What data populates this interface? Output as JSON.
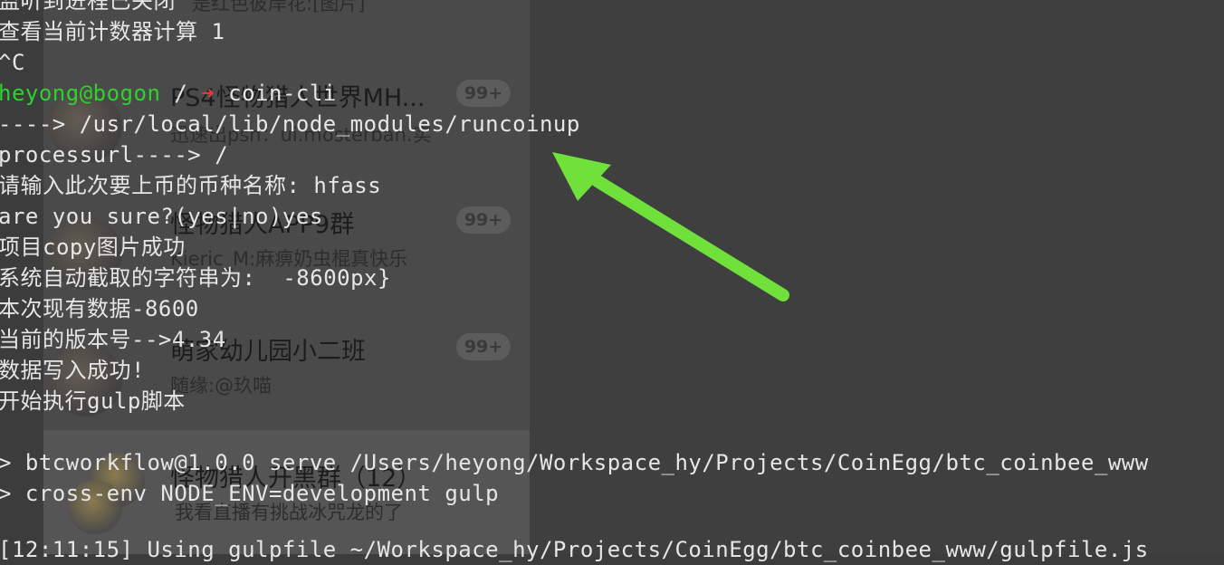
{
  "chat": {
    "items": [
      {
        "name": "PS4怪物猎人世界MH...",
        "preview": "迅速出psn：ui.mosterban.实",
        "badge": "99+"
      },
      {
        "name": "怪物猎人APP9群",
        "preview": "Kieric_M:麻痹奶虫棍真快乐",
        "badge": "99+"
      },
      {
        "name": "萌家幼儿园小二班",
        "preview": "随缘:@玖喵",
        "badge": "99+"
      },
      {
        "name": "怪物猎人开黑群（12）",
        "preview": "我看直播有挑战冰咒龙的了",
        "badge": ""
      }
    ],
    "top_preview": "是红色彼岸花:[图片]"
  },
  "terminal": {
    "lines": [
      {
        "text": "监听到进程已关闭"
      },
      {
        "text": "查看当前计数器计算 1"
      },
      {
        "text": "^C"
      },
      {
        "user": "heyong@bogon",
        "path": " / ",
        "arrow": "➜",
        "cmd": " coin-cli"
      },
      {
        "text": "----> /usr/local/lib/node_modules/runcoinup"
      },
      {
        "text": "processurl----> /"
      },
      {
        "text": "请输入此次要上币的币种名称: hfass"
      },
      {
        "text": "are you sure?(yes|no)yes"
      },
      {
        "text": "项目copy图片成功"
      },
      {
        "text": "系统自动截取的字符串为:  -8600px}"
      },
      {
        "text": "本次现有数据-8600"
      },
      {
        "text": "当前的版本号-->4.34"
      },
      {
        "text": "数据写入成功!"
      },
      {
        "text": "开始执行gulp脚本"
      },
      {
        "text": ""
      },
      {
        "text": "> btcworkflow@1.0.0 serve /Users/heyong/Workspace_hy/Projects/CoinEgg/btc_coinbee_www"
      },
      {
        "text": "> cross-env NODE_ENV=development gulp"
      },
      {
        "text": ""
      },
      {
        "text": "[12:11:15] Using gulpfile ~/Workspace_hy/Projects/CoinEgg/btc_coinbee_www/gulpfile.js"
      }
    ]
  },
  "colors": {
    "arrow": "#6fe13a",
    "prompt_user": "#2fd12f",
    "prompt_arrow": "#e03a3a"
  },
  "annotation": {
    "icon": "arrow-pointer-icon"
  }
}
